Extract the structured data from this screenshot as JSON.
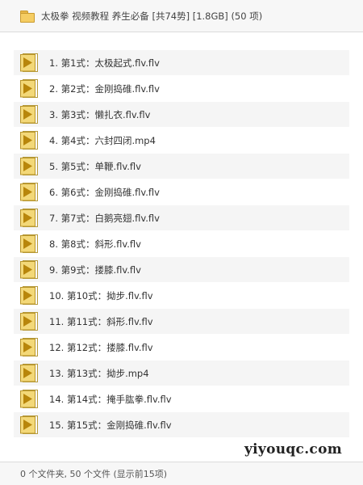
{
  "header": {
    "icon": "folder-icon",
    "title": "太极拳 视频教程 养生必备 [共74势] [1.8GB] (50 项)"
  },
  "files": [
    {
      "label": "1. 第1式：太极起式.flv.flv",
      "icon": "video-file-icon"
    },
    {
      "label": "2. 第2式：金刚捣碓.flv.flv",
      "icon": "video-file-icon"
    },
    {
      "label": "3. 第3式：懒扎衣.flv.flv",
      "icon": "video-file-icon"
    },
    {
      "label": "4. 第4式：六封四闭.mp4",
      "icon": "video-file-icon"
    },
    {
      "label": "5. 第5式：单鞭.flv.flv",
      "icon": "video-file-icon"
    },
    {
      "label": "6. 第6式：金刚捣碓.flv.flv",
      "icon": "video-file-icon"
    },
    {
      "label": "7. 第7式：白鹅亮翅.flv.flv",
      "icon": "video-file-icon"
    },
    {
      "label": "8. 第8式：斜形.flv.flv",
      "icon": "video-file-icon"
    },
    {
      "label": "9. 第9式：搂膝.flv.flv",
      "icon": "video-file-icon"
    },
    {
      "label": "10. 第10式：拗步.flv.flv",
      "icon": "video-file-icon"
    },
    {
      "label": "11. 第11式：斜形.flv.flv",
      "icon": "video-file-icon"
    },
    {
      "label": "12. 第12式：搂膝.flv.flv",
      "icon": "video-file-icon"
    },
    {
      "label": "13. 第13式：拗步.mp4",
      "icon": "video-file-icon"
    },
    {
      "label": "14. 第14式：掩手肱拳.flv.flv",
      "icon": "video-file-icon"
    },
    {
      "label": "15. 第15式：金刚捣碓.flv.flv",
      "icon": "video-file-icon"
    }
  ],
  "footer": {
    "status": "0 个文件夹, 50 个文件 (显示前15项)"
  },
  "watermark": "yiyouqc.com",
  "colors": {
    "row_alt_background": "#f5f5f5",
    "file_icon_fill": "#f3d878",
    "file_icon_play": "#b8860b"
  }
}
